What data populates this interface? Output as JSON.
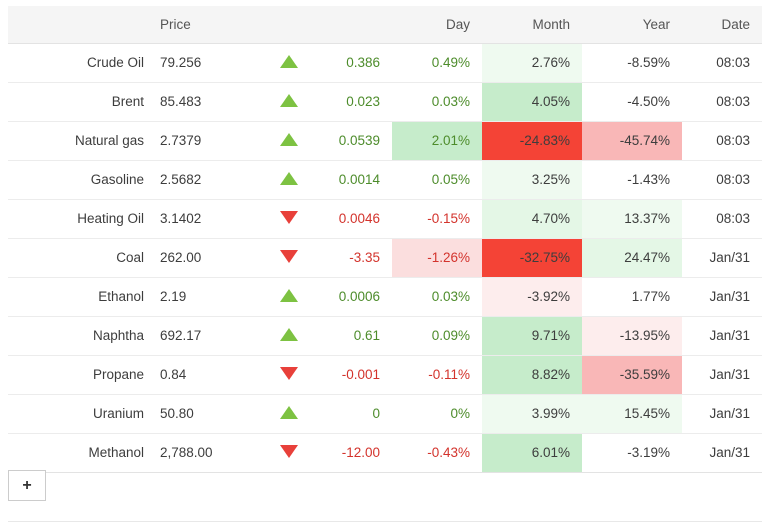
{
  "table": {
    "columns": [
      {
        "key": "name",
        "label": ""
      },
      {
        "key": "price",
        "label": "Price"
      },
      {
        "key": "arrow",
        "label": ""
      },
      {
        "key": "change",
        "label": ""
      },
      {
        "key": "day",
        "label": "Day"
      },
      {
        "key": "month",
        "label": "Month"
      },
      {
        "key": "year",
        "label": "Year"
      },
      {
        "key": "date",
        "label": "Date"
      }
    ],
    "rows": [
      {
        "name": "Crude Oil",
        "price": "79.256",
        "arrow": "triangle-up-icon",
        "direction": "up",
        "change": "0.386",
        "change_dir": "up",
        "day": "0.49%",
        "day_dir": "up",
        "month": "2.76%",
        "month_tint": "tint-g1",
        "year": "-8.59%",
        "year_tint": "",
        "date": "08:03"
      },
      {
        "name": "Brent",
        "price": "85.483",
        "arrow": "triangle-up-icon",
        "direction": "up",
        "change": "0.023",
        "change_dir": "up",
        "day": "0.03%",
        "day_dir": "up",
        "month": "4.05%",
        "month_tint": "tint-g3",
        "year": "-4.50%",
        "year_tint": "",
        "date": "08:03"
      },
      {
        "name": "Natural gas",
        "price": "2.7379",
        "arrow": "triangle-up-icon",
        "direction": "up",
        "change": "0.0539",
        "change_dir": "up",
        "day": "2.01%",
        "day_dir": "up",
        "day_tint": "tint-g3",
        "month": "-24.83%",
        "month_tint": "tint-r4",
        "year": "-45.74%",
        "year_tint": "tint-r3",
        "date": "08:03"
      },
      {
        "name": "Gasoline",
        "price": "2.5682",
        "arrow": "triangle-up-icon",
        "direction": "up",
        "change": "0.0014",
        "change_dir": "up",
        "day": "0.05%",
        "day_dir": "up",
        "month": "3.25%",
        "month_tint": "tint-g1",
        "year": "-1.43%",
        "year_tint": "",
        "date": "08:03"
      },
      {
        "name": "Heating Oil",
        "price": "3.1402",
        "arrow": "triangle-down-icon",
        "direction": "down",
        "change": "0.0046",
        "change_dir": "down",
        "day": "-0.15%",
        "day_dir": "down",
        "month": "4.70%",
        "month_tint": "tint-g2",
        "year": "13.37%",
        "year_tint": "tint-g1",
        "date": "08:03"
      },
      {
        "name": "Coal",
        "price": "262.00",
        "arrow": "triangle-down-icon",
        "direction": "down",
        "change": "-3.35",
        "change_dir": "down",
        "day": "-1.26%",
        "day_dir": "down",
        "day_tint": "tint-r2",
        "month": "-32.75%",
        "month_tint": "tint-r4",
        "year": "24.47%",
        "year_tint": "tint-g2",
        "date": "Jan/31"
      },
      {
        "name": "Ethanol",
        "price": "2.19",
        "arrow": "triangle-up-icon",
        "direction": "up",
        "change": "0.0006",
        "change_dir": "up",
        "day": "0.03%",
        "day_dir": "up",
        "month": "-3.92%",
        "month_tint": "tint-r1",
        "year": "1.77%",
        "year_tint": "",
        "date": "Jan/31"
      },
      {
        "name": "Naphtha",
        "price": "692.17",
        "arrow": "triangle-up-icon",
        "direction": "up",
        "change": "0.61",
        "change_dir": "up",
        "day": "0.09%",
        "day_dir": "up",
        "month": "9.71%",
        "month_tint": "tint-g3",
        "year": "-13.95%",
        "year_tint": "tint-r1",
        "date": "Jan/31"
      },
      {
        "name": "Propane",
        "price": "0.84",
        "arrow": "triangle-down-icon",
        "direction": "down",
        "change": "-0.001",
        "change_dir": "down",
        "day": "-0.11%",
        "day_dir": "down",
        "month": "8.82%",
        "month_tint": "tint-g3",
        "year": "-35.59%",
        "year_tint": "tint-r3",
        "date": "Jan/31"
      },
      {
        "name": "Uranium",
        "price": "50.80",
        "arrow": "triangle-up-icon",
        "direction": "up",
        "change": "0",
        "change_dir": "up",
        "day": "0%",
        "day_dir": "up",
        "month": "3.99%",
        "month_tint": "tint-g1",
        "year": "15.45%",
        "year_tint": "tint-g1",
        "date": "Jan/31"
      },
      {
        "name": "Methanol",
        "price": "2,788.00",
        "arrow": "triangle-down-icon",
        "direction": "down",
        "change": "-12.00",
        "change_dir": "down",
        "day": "-0.43%",
        "day_dir": "down",
        "month": "6.01%",
        "month_tint": "tint-g3",
        "year": "-3.19%",
        "year_tint": "",
        "date": "Jan/31"
      }
    ]
  },
  "footer": {
    "add_label": "+"
  },
  "colors": {
    "up_text": "#4d8c2b",
    "down_text": "#d3332c",
    "up_arrow": "#7dc242",
    "down_arrow": "#e8403a",
    "header_bg": "#f5f5f5",
    "strong_red": "#f44336",
    "strong_green": "#b6e7bd"
  }
}
